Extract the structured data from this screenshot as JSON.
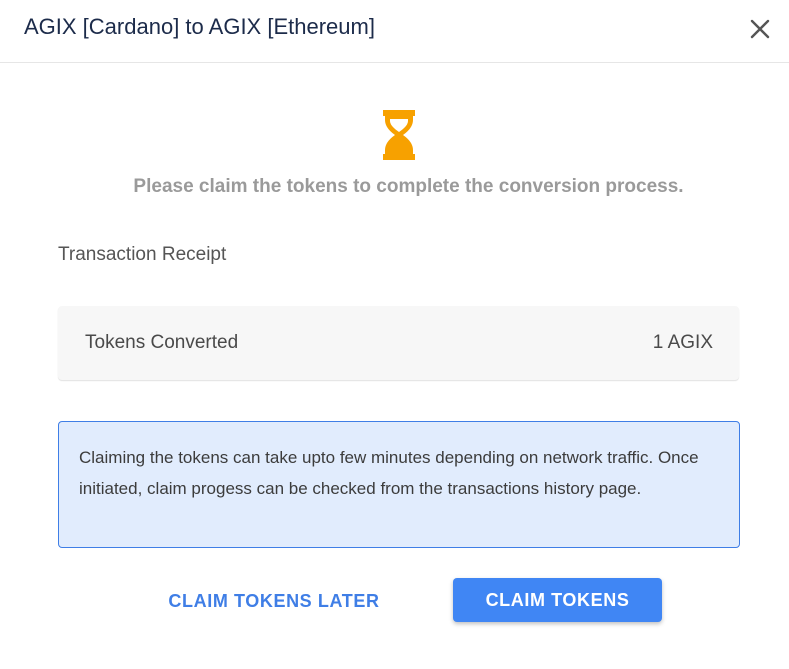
{
  "dialog": {
    "title": "AGIX [Cardano] to AGIX [Ethereum]",
    "close_icon": "close-icon"
  },
  "status": {
    "icon": "hourglass-icon",
    "icon_color": "#f7a100",
    "message": "Please claim the tokens to complete the conversion process."
  },
  "receipt": {
    "title": "Transaction Receipt",
    "label": "Tokens Converted",
    "value": "1 AGIX"
  },
  "info": {
    "text": "Claiming the tokens can take upto few minutes depending on network traffic. Once initiated, claim progess can be checked from the transactions history page."
  },
  "actions": {
    "later_label": "CLAIM TOKENS LATER",
    "claim_label": "CLAIM TOKENS",
    "primary_color": "#4086f4"
  }
}
